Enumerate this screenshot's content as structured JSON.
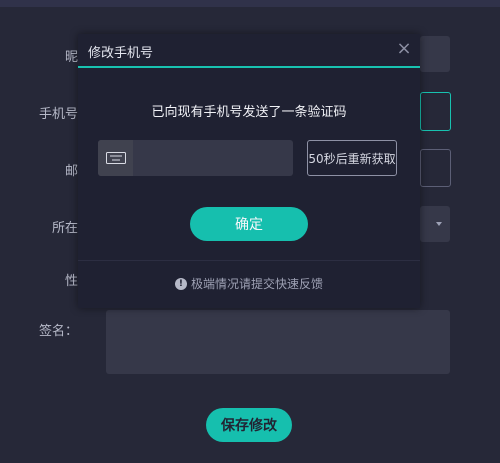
{
  "form": {
    "fields": [
      {
        "label": "昵"
      },
      {
        "label": "手机号"
      },
      {
        "label": "邮"
      },
      {
        "label": "所在"
      },
      {
        "label": "性"
      },
      {
        "label": "签名："
      }
    ],
    "save_label": "保存修改"
  },
  "modal": {
    "title": "修改手机号",
    "close_icon": "×",
    "message": "已向现有手机号发送了一条验证码",
    "code_input": {
      "value": "",
      "placeholder": ""
    },
    "resend_label": "50秒后重新获取",
    "confirm_label": "确定",
    "feedback_text": "极端情况请提交快速反馈",
    "accent_color": "#18c2b0"
  },
  "icons": {
    "code": "keyboard-icon",
    "feedback": "exclamation-circle-icon",
    "close": "close-icon",
    "select": "chevron-down-icon"
  }
}
